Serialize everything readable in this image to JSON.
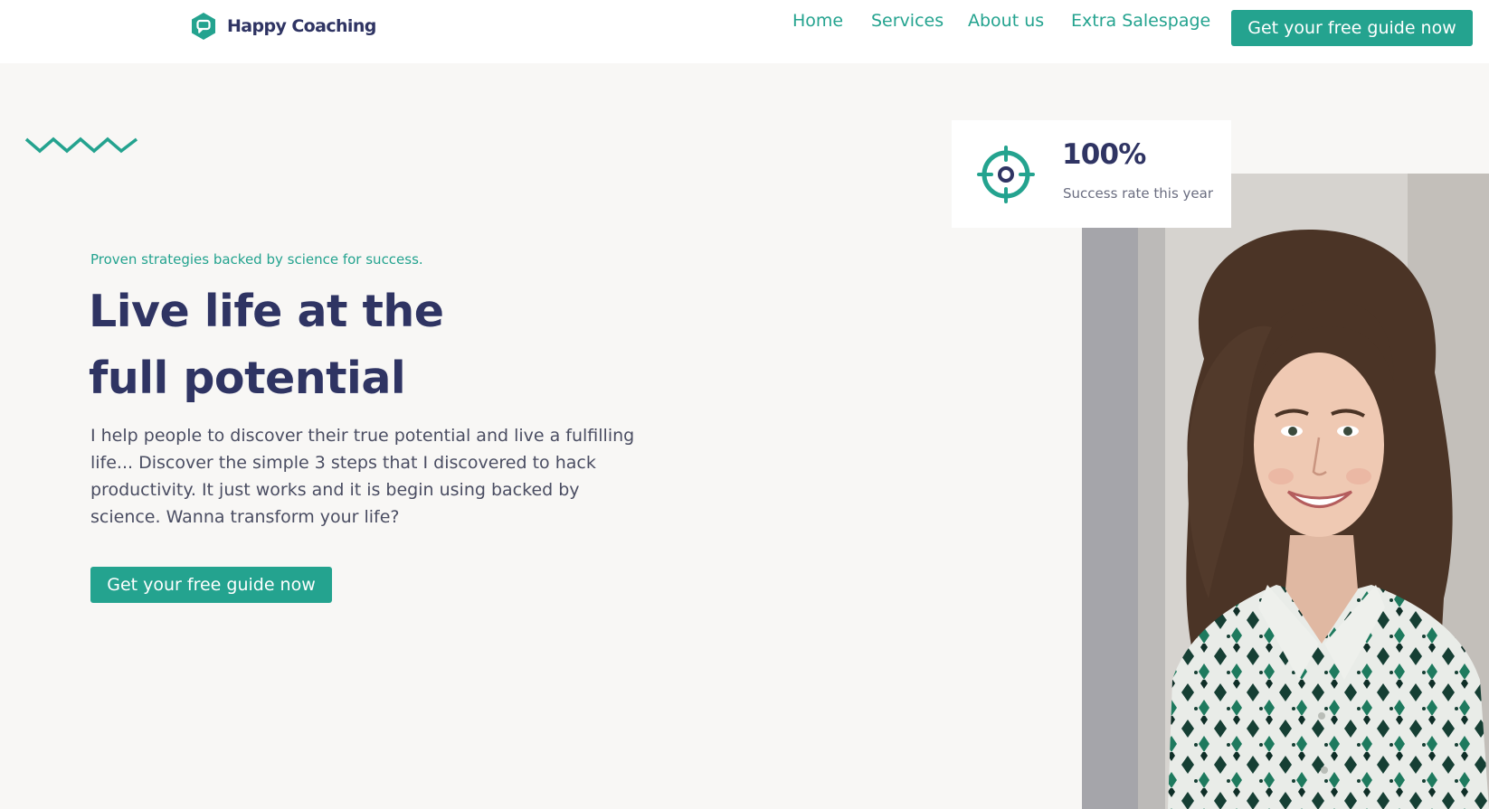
{
  "brand": {
    "name": "Happy Coaching",
    "accent_color": "#24a38f",
    "dark_color": "#2f3463"
  },
  "nav": {
    "items": [
      {
        "label": "Home"
      },
      {
        "label": "Services"
      },
      {
        "label": "About us"
      },
      {
        "label": "Extra Salespage"
      }
    ],
    "cta_label": "Get your free guide now"
  },
  "hero": {
    "tagline": "Proven strategies backed by science for success.",
    "headline_line1": "Live life at the",
    "headline_line2": "full potential",
    "intro": "I help people to discover their true potential and live a fulfilling life... Discover the simple 3 steps that I discovered to hack productivity. It just works and it is begin using backed by science. Wanna transform your life?",
    "cta_label": "Get your free guide now"
  },
  "stat": {
    "icon": "target-icon",
    "value": "100%",
    "label": "Success rate this year"
  },
  "photo": {
    "icon": "smiling-woman-photo"
  }
}
